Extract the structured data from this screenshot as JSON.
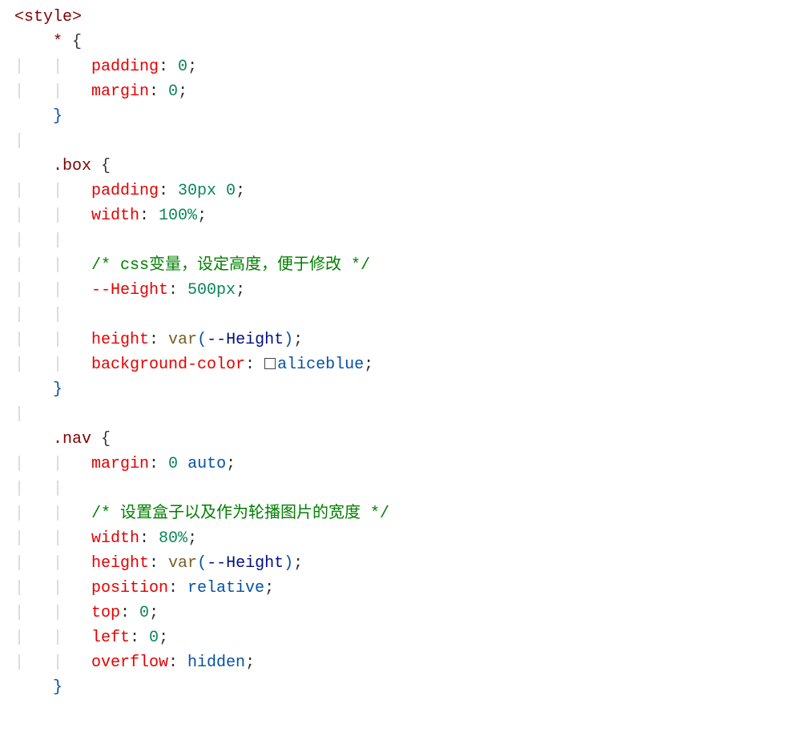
{
  "code": {
    "open_tag": "<style>",
    "indent1": "    ",
    "indent2": "        ",
    "guide1": "|   ",
    "guide2": "|   |   ",
    "universal": {
      "selector": "*",
      "open": "{",
      "close": "}",
      "p1_prop": "padding",
      "p1_val": "0",
      "p2_prop": "margin",
      "p2_val": "0"
    },
    "box": {
      "selector": ".box",
      "open": "{",
      "close": "}",
      "p1_prop": "padding",
      "p1_val": "30px 0",
      "p2_prop": "width",
      "p2_val": "100%",
      "comment1": "/* css变量，设定高度，便于修改 */",
      "p3_prop": "--Height",
      "p3_val": "500px",
      "p4_prop": "height",
      "p4_fn": "var",
      "p4_var": "--Height",
      "p5_prop": "background-color",
      "p5_val": "aliceblue"
    },
    "nav": {
      "selector": ".nav",
      "open": "{",
      "close": "}",
      "p1_prop": "margin",
      "p1_val_num": "0",
      "p1_val_kw": "auto",
      "comment1": "/* 设置盒子以及作为轮播图片的宽度 */",
      "p2_prop": "width",
      "p2_val": "80%",
      "p3_prop": "height",
      "p3_fn": "var",
      "p3_var": "--Height",
      "p4_prop": "position",
      "p4_val": "relative",
      "p5_prop": "top",
      "p5_val": "0",
      "p6_prop": "left",
      "p6_val": "0",
      "p7_prop": "overflow",
      "p7_val": "hidden"
    }
  }
}
